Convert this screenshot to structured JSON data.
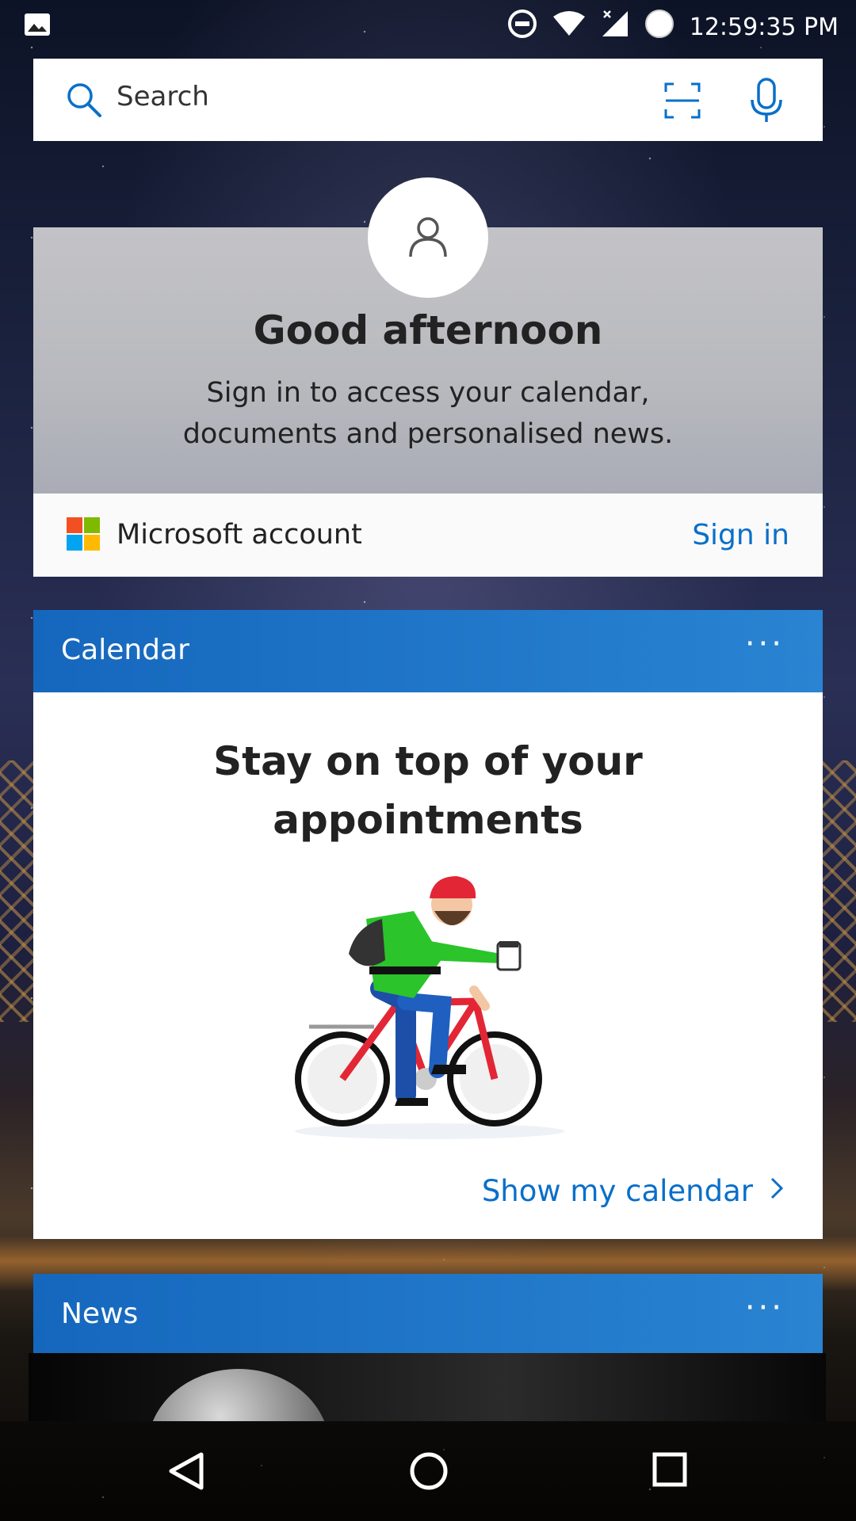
{
  "status_bar": {
    "time": "12:59:35 PM",
    "icons": [
      "gallery-icon",
      "do-not-disturb-icon",
      "wifi-icon",
      "signal-icon",
      "battery-icon"
    ]
  },
  "search": {
    "placeholder": "Search",
    "icons": [
      "search-icon",
      "scan-icon",
      "microphone-icon"
    ]
  },
  "greeting": {
    "title": "Good afternoon",
    "subtitle_line1": "Sign in to access your calendar,",
    "subtitle_line2": "documents and personalised news."
  },
  "account": {
    "label": "Microsoft account",
    "action": "Sign in"
  },
  "calendar": {
    "title": "Calendar",
    "more": "···",
    "headline_line1": "Stay on top of your",
    "headline_line2": "appointments",
    "link": "Show my calendar"
  },
  "news": {
    "title": "News",
    "more": "···"
  },
  "colors": {
    "accent": "#0a6fc9",
    "header_blue": "#1a6fc4",
    "card_white": "#ffffff"
  },
  "nav_bar": {
    "buttons": [
      "back-icon",
      "home-icon",
      "recents-icon"
    ]
  }
}
